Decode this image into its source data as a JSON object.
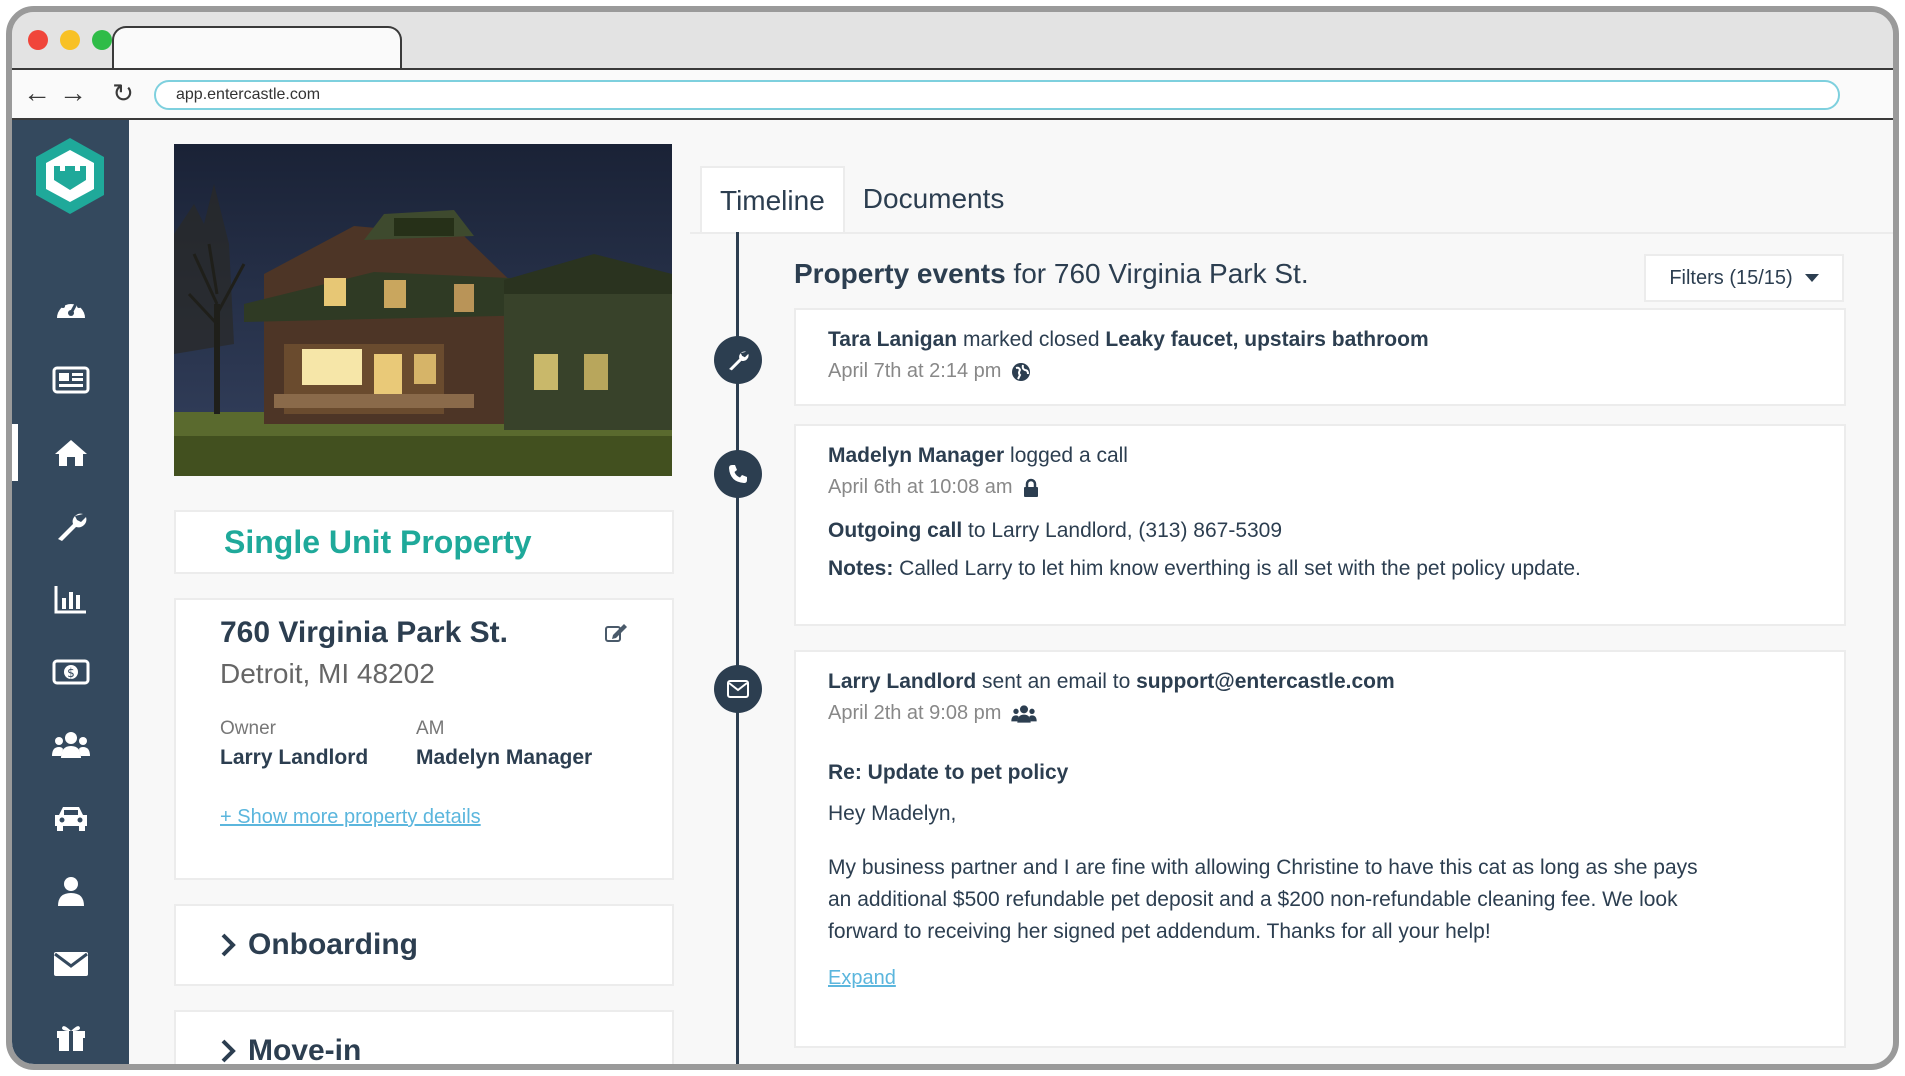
{
  "browser": {
    "url": "app.entercastle.com",
    "back_icon": "arrow-left-icon",
    "forward_icon": "arrow-right-icon",
    "reload_icon": "reload-icon"
  },
  "sidebar": {
    "logo": "castle-logo",
    "items": [
      {
        "icon": "dashboard-icon",
        "active": false
      },
      {
        "icon": "newspaper-icon",
        "active": false
      },
      {
        "icon": "home-icon",
        "active": true
      },
      {
        "icon": "wrench-icon",
        "active": false
      },
      {
        "icon": "bar-chart-icon",
        "active": false
      },
      {
        "icon": "money-icon",
        "active": false
      },
      {
        "icon": "people-icon",
        "active": false
      },
      {
        "icon": "car-icon",
        "active": false
      },
      {
        "icon": "user-icon",
        "active": false
      },
      {
        "icon": "envelope-icon",
        "active": false
      },
      {
        "icon": "gift-icon",
        "active": false
      }
    ],
    "accent": "#34495e"
  },
  "property": {
    "type": "Single Unit Property",
    "street": "760 Virginia Park St.",
    "city": "Detroit, MI 48202",
    "owner_label": "Owner",
    "owner_name": "Larry Landlord",
    "am_label": "AM",
    "am_name": "Madelyn Manager",
    "more_link": "+ Show more property details",
    "sections": [
      "Onboarding",
      "Move-in"
    ],
    "type_color": "#1fa99a"
  },
  "tabs": {
    "timeline": "Timeline",
    "documents": "Documents"
  },
  "events": {
    "header_bold": "Property events",
    "header_rest": " for 760 Virginia Park St.",
    "filters_label": "Filters (15/15)",
    "items": [
      {
        "icon": "wrench-icon",
        "actor": "Tara Lanigan",
        "action": " marked closed ",
        "target": "Leaky faucet, upstairs bathroom",
        "time": "April 7th at 2:14 pm",
        "visibility_icon": "globe-icon"
      },
      {
        "icon": "phone-icon",
        "actor": "Madelyn Manager",
        "action": " logged a call",
        "time": "April 6th at 10:08 am",
        "visibility_icon": "lock-icon",
        "call_label": "Outgoing call",
        "call_rest": " to Larry Landlord, (313) 867-5309",
        "notes_label": "Notes:",
        "notes_text": " Called Larry to let him know everthing is all set with the pet policy update."
      },
      {
        "icon": "envelope-icon",
        "actor": "Larry Landlord",
        "action": " sent an email to ",
        "target": "support@entercastle.com",
        "time": "April 2th at 9:08 pm",
        "visibility_icon": "people-icon",
        "subject": "Re: Update to pet policy",
        "greeting": "Hey Madelyn,",
        "body_lines": [
          "My business partner and I are fine with allowing Christine to have this cat as long as she pays",
          "an additional $500 refundable pet deposit and a $200 non-refundable cleaning fee. We look",
          "forward to receiving her signed pet addendum. Thanks for all your help!"
        ],
        "expand": "Expand"
      }
    ]
  },
  "link_color": "#5bb6dd"
}
